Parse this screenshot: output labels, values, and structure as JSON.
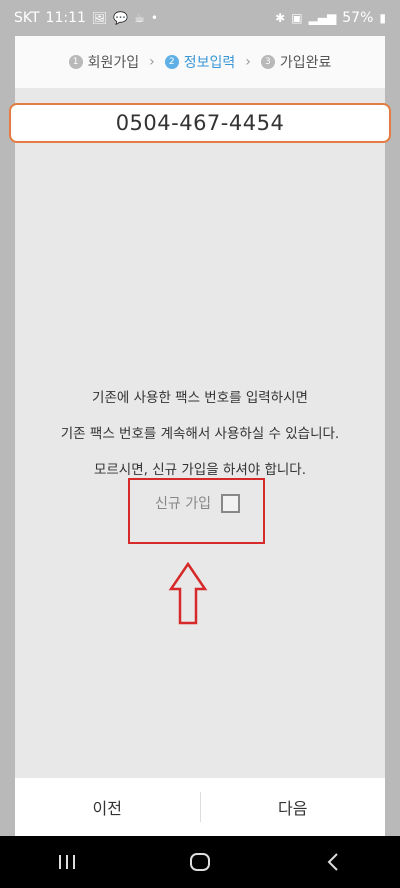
{
  "status_bar": {
    "carrier": "SKT",
    "time": "11:11",
    "battery": "57%"
  },
  "steps": [
    {
      "num": "1",
      "label": "회원가입"
    },
    {
      "num": "2",
      "label": "정보입력"
    },
    {
      "num": "3",
      "label": "가입완료"
    }
  ],
  "fax_number": "0504-467-4454",
  "notice": {
    "line1": "기존에 사용한 팩스 번호를 입력하시면",
    "line2": "기존 팩스 번호를 계속해서 사용하실 수 있습니다.",
    "line3": "모르시면, 신규 가입을 하셔야 합니다."
  },
  "new_join_label": "신규 가입",
  "footer": {
    "prev": "이전",
    "next": "다음"
  },
  "colors": {
    "active_step": "#3a97d6",
    "field_border": "#e27c43",
    "highlight_red": "#d62a2a"
  },
  "icons": [
    "gallery-icon",
    "chat-icon",
    "coffee-icon",
    "bluetooth-icon",
    "volte-icon",
    "signal-icon",
    "battery-icon",
    "step-chevron-icon",
    "red-up-arrow-icon",
    "recents-icon",
    "home-icon",
    "back-icon"
  ]
}
